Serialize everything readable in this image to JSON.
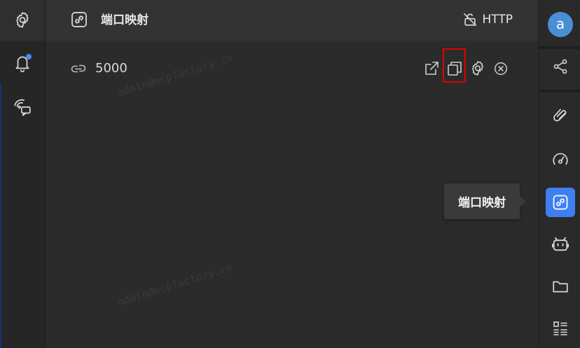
{
  "header": {
    "title": "端口映射",
    "protocol_label": "HTTP"
  },
  "port_mapping": {
    "port": "5000"
  },
  "tooltip": {
    "text": "端口映射"
  },
  "user": {
    "avatar_letter": "a"
  },
  "watermark": {
    "text": "admin@mcpfactory.cn"
  },
  "colors": {
    "accent": "#3e7ff2",
    "notification_dot": "#4c8bf5",
    "highlight_box": "#e00000",
    "avatar_bg": "#4a8fd6"
  },
  "icons": {
    "left_sidebar": [
      "gear-icon",
      "bell-icon",
      "chat-signal-icon"
    ],
    "header": "link-icon",
    "protocol": "lock-off-icon",
    "row_actions": [
      "external-link-icon",
      "copy-icon",
      "gear-icon",
      "close-circle-icon"
    ],
    "right_sidebar": [
      "share-icon",
      "paperclip-icon",
      "speedometer-icon",
      "link-icon",
      "robot-icon",
      "folder-icon",
      "list-grid-icon"
    ]
  }
}
